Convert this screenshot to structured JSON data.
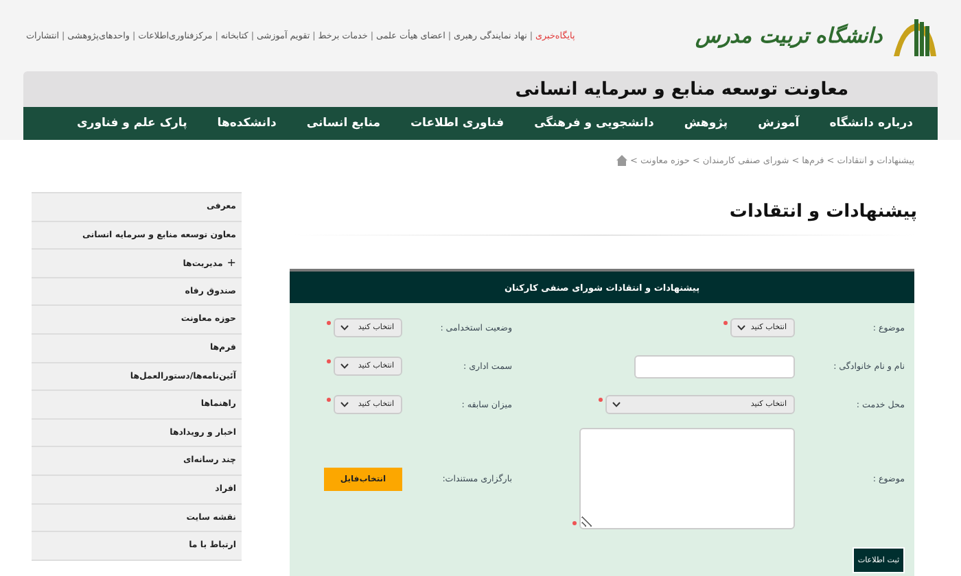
{
  "logo": {
    "text": "دانشگاه تربیت مدرس"
  },
  "top_links": [
    {
      "label": "پایگاه‌خبری",
      "highlighted": true
    },
    {
      "label": "نهاد نمایندگی رهبری",
      "highlighted": false
    },
    {
      "label": "اعضای هیأت علمی",
      "highlighted": false
    },
    {
      "label": "خدمات برخط",
      "highlighted": false
    },
    {
      "label": "تقویم آموزشی",
      "highlighted": false
    },
    {
      "label": "کتابخانه",
      "highlighted": false
    },
    {
      "label": "مرکزفناوری‌اطلاعات",
      "highlighted": false
    },
    {
      "label": "واحدهای‌پژوهشی",
      "highlighted": false
    },
    {
      "label": "انتشارات",
      "highlighted": false
    }
  ],
  "top_links_separator": "|",
  "site_title": "معاونت توسعه منابع و سرمایه انسانی",
  "nav": [
    "درباره دانشگاه",
    "آموزش",
    "پژوهش",
    "دانشجویی و فرهنگی",
    "فناوری اطلاعات",
    "منابع انسانی",
    "دانشکده‌ها",
    "پارک علم و فناوری"
  ],
  "breadcrumb": {
    "separator": ">",
    "items": [
      "پیشنهادات و انتقادات",
      "فرم‌ها",
      "شورای صنفی کارمندان",
      "حوزه معاونت"
    ]
  },
  "page_title": "پیشنهادات و انتقادات",
  "form": {
    "title": "پیشنهادات و انتقادات شورای صنفی کارکنان",
    "fields": [
      {
        "label": "موضوع :",
        "kind": "select",
        "value": "انتخاب کنید",
        "required": true
      },
      {
        "label": "وضعیت استخدامی :",
        "kind": "select",
        "value": "انتخاب کنید",
        "required": true
      },
      {
        "label": "نام و نام خانوادگی :",
        "kind": "input",
        "required": false
      },
      {
        "label": "سمت اداری :",
        "kind": "select",
        "value": "انتخاب کنید",
        "required": true
      },
      {
        "label": "محل خدمت :",
        "kind": "select-wide",
        "value": "انتخاب کنید",
        "required": true
      },
      {
        "label": "میزان سابقه :",
        "kind": "select",
        "value": "انتخاب کنید",
        "required": true
      },
      {
        "label": "موضوع :",
        "kind": "textarea",
        "required": true
      },
      {
        "label": "بارگزاری مستندات:",
        "kind": "file",
        "value": "انتخاب‌فایل",
        "required": false
      }
    ],
    "submit": "ثبت اطلاعات"
  },
  "sidebar": [
    {
      "label": "معرفی"
    },
    {
      "label": "معاون توسعه منابع و سرمایه انسانی"
    },
    {
      "label": "مدیریت‌ها",
      "expander": "+"
    },
    {
      "label": "صندوق رفاه"
    },
    {
      "label": "حوزه معاونت"
    },
    {
      "label": "فرم‌ها"
    },
    {
      "label": "آئین‌نامه‌ها/دستورالعمل‌ها"
    },
    {
      "label": "راهنماها"
    },
    {
      "label": "اخبار و رویدادها"
    },
    {
      "label": "چند رسانه‌ای"
    },
    {
      "label": "افراد"
    },
    {
      "label": "نقشه سایت"
    },
    {
      "label": "ارتباط با ما"
    }
  ]
}
